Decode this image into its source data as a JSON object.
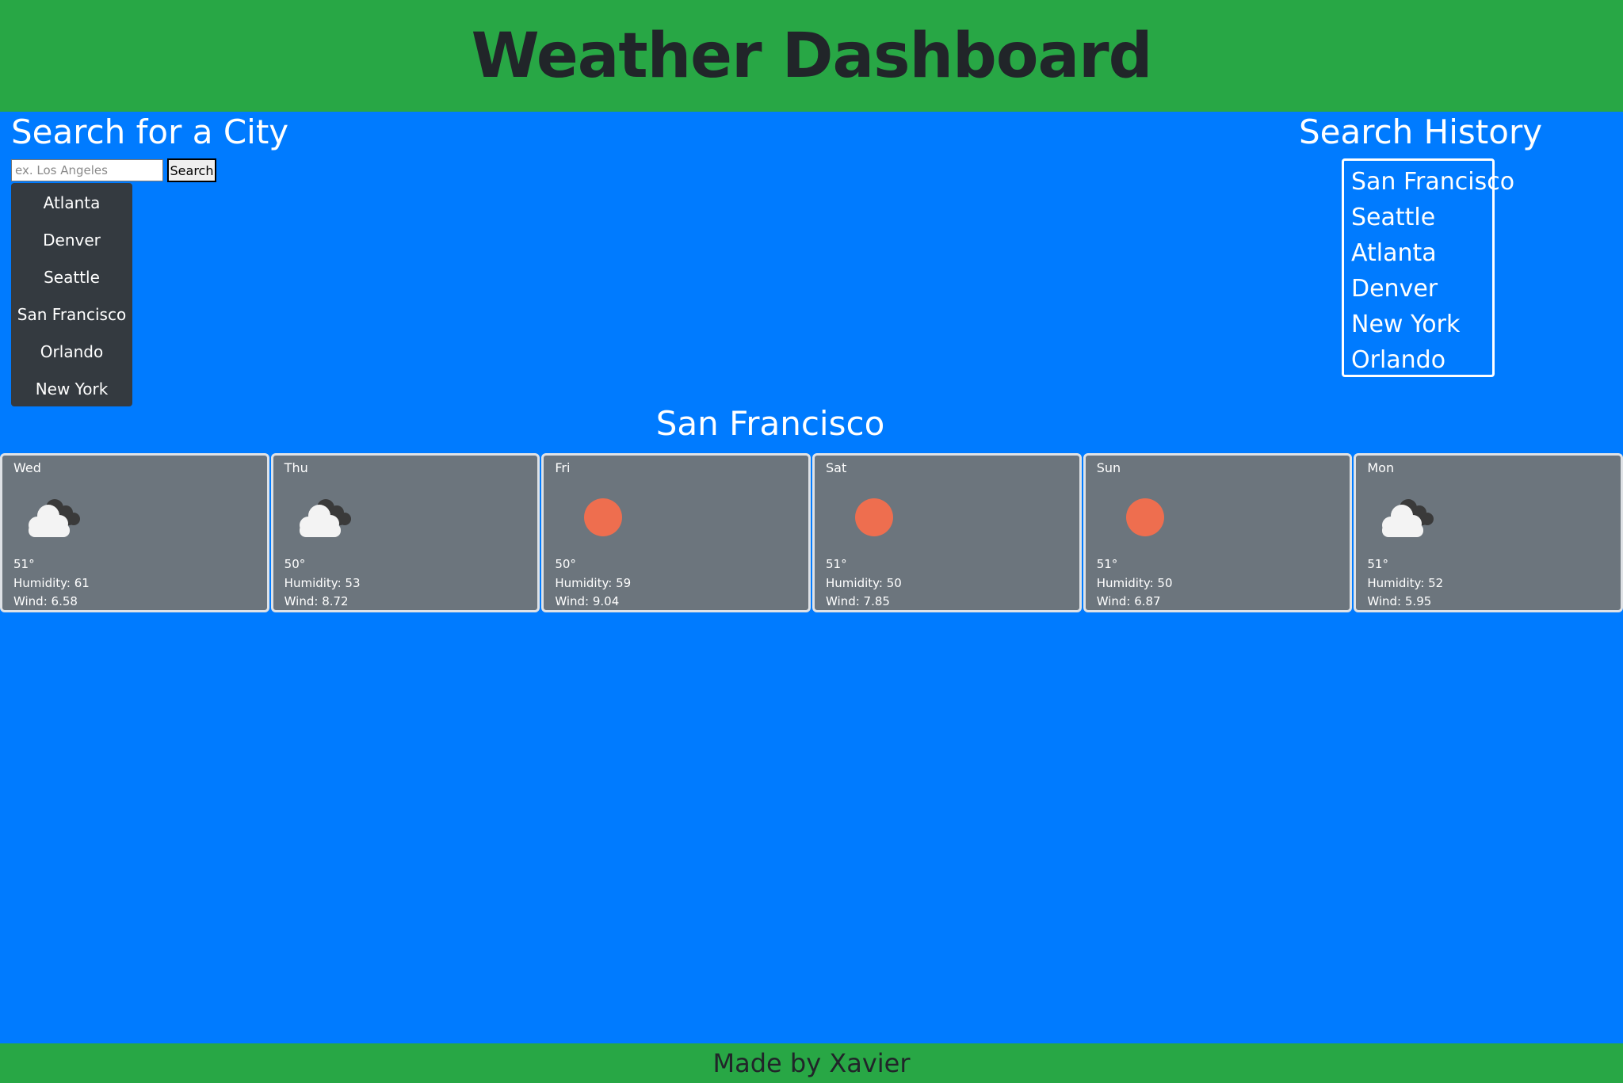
{
  "header": {
    "title": "Weather Dashboard"
  },
  "search": {
    "title": "Search for a City",
    "placeholder": "ex. Los Angeles",
    "value": "",
    "button_label": "Search",
    "cities": [
      "Atlanta",
      "Denver",
      "Seattle",
      "San Francisco",
      "Orlando",
      "New York"
    ]
  },
  "history": {
    "title": "Search History",
    "items": [
      "San Francisco",
      "Seattle",
      "Atlanta",
      "Denver",
      "New York",
      "Orlando"
    ]
  },
  "forecast": {
    "city": "San Francisco",
    "days": [
      {
        "day": "Wed",
        "icon": "cloudy-icon",
        "temp": "51°",
        "humidity": "Humidity: 61",
        "wind": "Wind: 6.58"
      },
      {
        "day": "Thu",
        "icon": "cloudy-icon",
        "temp": "50°",
        "humidity": "Humidity: 53",
        "wind": "Wind: 8.72"
      },
      {
        "day": "Fri",
        "icon": "sun-icon",
        "temp": "50°",
        "humidity": "Humidity: 59",
        "wind": "Wind: 9.04"
      },
      {
        "day": "Sat",
        "icon": "sun-icon",
        "temp": "51°",
        "humidity": "Humidity: 50",
        "wind": "Wind: 7.85"
      },
      {
        "day": "Sun",
        "icon": "sun-icon",
        "temp": "51°",
        "humidity": "Humidity: 50",
        "wind": "Wind: 6.87"
      },
      {
        "day": "Mon",
        "icon": "cloudy-icon",
        "temp": "51°",
        "humidity": "Humidity: 52",
        "wind": "Wind: 5.95"
      }
    ]
  },
  "footer": {
    "text": "Made by Xavier"
  },
  "colors": {
    "header_bg": "#28a745",
    "page_bg": "#007bff",
    "city_list_bg": "#343a40",
    "card_bg": "#6c757d",
    "sun": "#ee6e4f",
    "cloud_front": "#f3f3f3",
    "cloud_back": "#3a3a3a"
  }
}
